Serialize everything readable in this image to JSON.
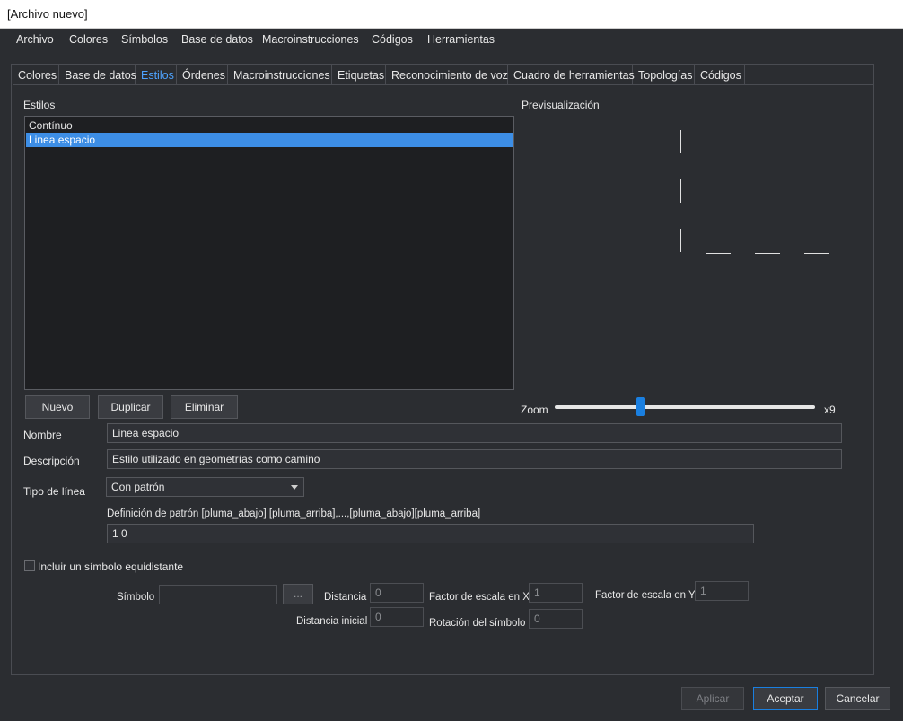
{
  "window": {
    "title": "[Archivo nuevo]"
  },
  "menubar": [
    "Archivo",
    "Colores",
    "Símbolos",
    "Base de datos",
    "Macroinstrucciones",
    "Códigos",
    "Herramientas"
  ],
  "tabs": [
    "Colores",
    "Base de datos",
    "Estilos",
    "Órdenes",
    "Macroinstrucciones",
    "Etiquetas",
    "Reconocimiento de voz",
    "Cuadro de herramientas",
    "Topologías",
    "Códigos"
  ],
  "active_tab": "Estilos",
  "styles_section": {
    "label": "Estilos",
    "items": [
      "Contínuo",
      "Linea espacio"
    ],
    "selected": "Linea espacio",
    "buttons": {
      "new": "Nuevo",
      "duplicate": "Duplicar",
      "delete": "Eliminar"
    }
  },
  "preview": {
    "label": "Previsualización",
    "zoom_label": "Zoom",
    "zoom_value_label": "x9",
    "zoom_fraction": 0.33
  },
  "form": {
    "name_label": "Nombre",
    "name_value": "Linea espacio",
    "description_label": "Descripción",
    "description_value": "Estilo utilizado en geometrías como camino",
    "linetype_label": "Tipo de línea",
    "linetype_value": "Con patrón",
    "pattern_label": "Definición de patrón [pluma_abajo] [pluma_arriba],...,[pluma_abajo][pluma_arriba]",
    "pattern_value": "1 0"
  },
  "symbol_section": {
    "checkbox_label": "Incluir un símbolo equidistante",
    "checked": false,
    "symbol_label": "Símbolo",
    "symbol_value": "",
    "browse_label": "...",
    "distance_label": "Distancia",
    "distance_value": "0",
    "initial_distance_label": "Distancia inicial",
    "initial_distance_value": "0",
    "scale_x_label": "Factor de escala en X",
    "scale_x_value": "1",
    "rotation_label": "Rotación del símbolo",
    "rotation_value": "0",
    "scale_y_label": "Factor de escala en Y",
    "scale_y_value": "1"
  },
  "footer": {
    "apply": "Aplicar",
    "accept": "Aceptar",
    "cancel": "Cancelar"
  },
  "colors": {
    "accent": "#3d8ee6",
    "background": "#2b2d31",
    "active_tab_text": "#4ea3ff"
  }
}
